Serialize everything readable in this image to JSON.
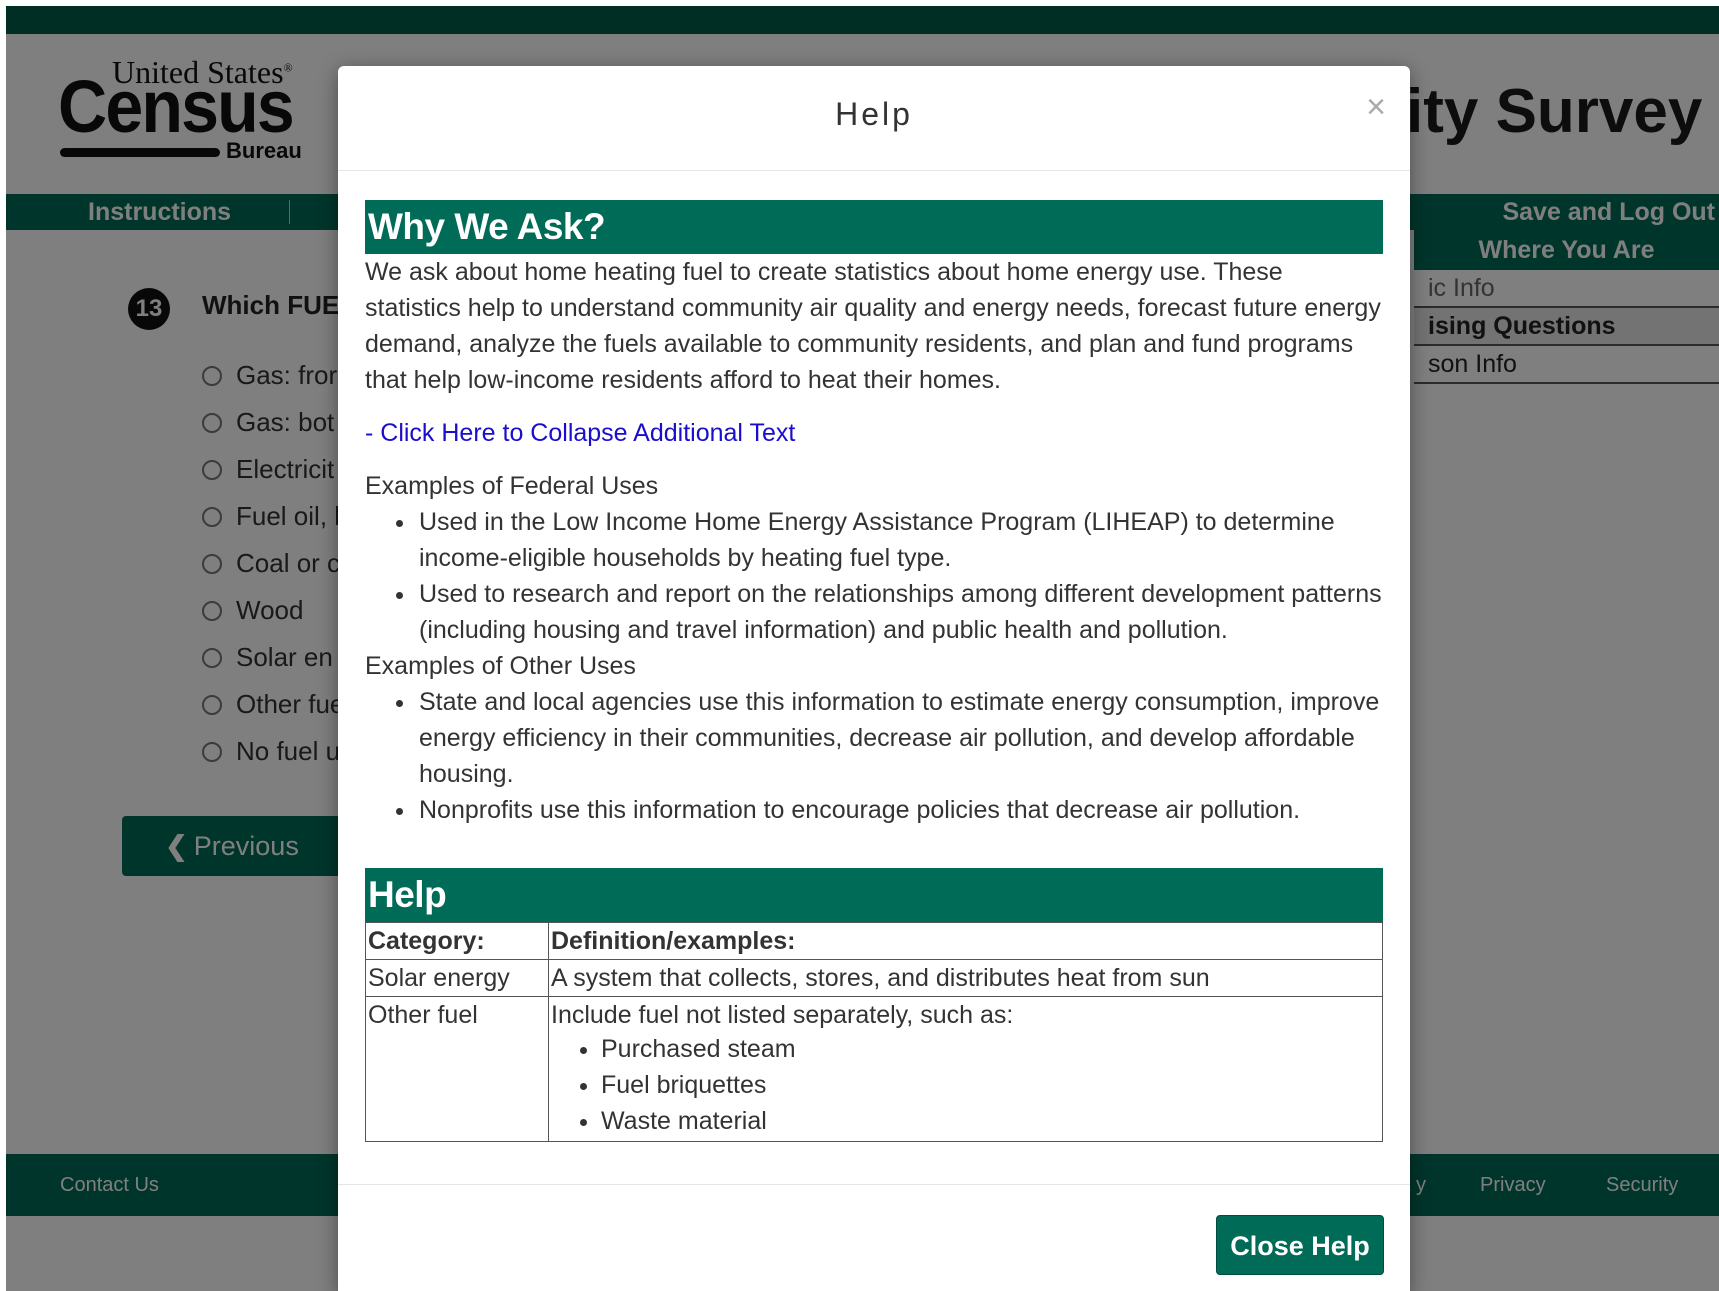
{
  "header": {
    "logo_top": "United States",
    "logo_reg": "®",
    "logo_main": "Census",
    "logo_bottom": "Bureau",
    "survey_title": "ity Survey"
  },
  "nav": {
    "instructions": "Instructions",
    "save_logout": "Save and Log Out"
  },
  "sidebar": {
    "title": "Where You Are",
    "items": [
      {
        "label": "ic Info"
      },
      {
        "label": "ising Questions"
      },
      {
        "label": "son Info"
      }
    ]
  },
  "question": {
    "number": "13",
    "text": "Which FUE",
    "options": [
      "Gas: fror",
      "Gas: bot",
      "Electricit",
      "Fuel oil, l",
      "Coal or c",
      "Wood",
      "Solar en",
      "Other fue",
      "No fuel u"
    ]
  },
  "buttons": {
    "previous": "Previous",
    "previous_icon": "chevron-left-icon"
  },
  "footer": {
    "contact": "Contact Us",
    "partial": "y",
    "privacy": "Privacy",
    "security": "Security"
  },
  "modal": {
    "title": "Help",
    "close_symbol": "×",
    "why_heading": "Why We Ask?",
    "why_text": "We ask about home heating fuel to create statistics about home energy use. These statistics help to understand community air quality and energy needs, forecast future energy demand, analyze the fuels available to community residents, and plan and fund programs that help low-income residents afford to heat their homes.",
    "collapse_link": "- Click Here to Collapse Additional Text",
    "federal_heading": "Examples of Federal Uses",
    "federal_uses": [
      "Used in the Low Income Home Energy Assistance Program (LIHEAP) to determine income-eligible households by heating fuel type.",
      "Used to research and report on the relationships among different development patterns (including housing and travel information) and public health and pollution."
    ],
    "other_heading": "Examples of Other Uses",
    "other_uses": [
      "State and local agencies use this information to estimate energy consumption, improve energy efficiency in their communities, decrease air pollution, and develop affordable housing.",
      "Nonprofits use this information to encourage policies that decrease air pollution."
    ],
    "help_heading": "Help",
    "table": {
      "col1": "Category:",
      "col2": "Definition/examples:",
      "rows": [
        {
          "category": "Solar energy",
          "definition": "A system that collects, stores, and distributes heat from sun"
        },
        {
          "category": "Other fuel",
          "definition": "Include fuel not listed separately, such as:",
          "items": [
            "Purchased steam",
            "Fuel briquettes",
            "Waste material"
          ]
        }
      ]
    },
    "close_button": "Close Help"
  },
  "colors": {
    "brand_green": "#006b57",
    "link_blue": "#1a0dcc"
  }
}
